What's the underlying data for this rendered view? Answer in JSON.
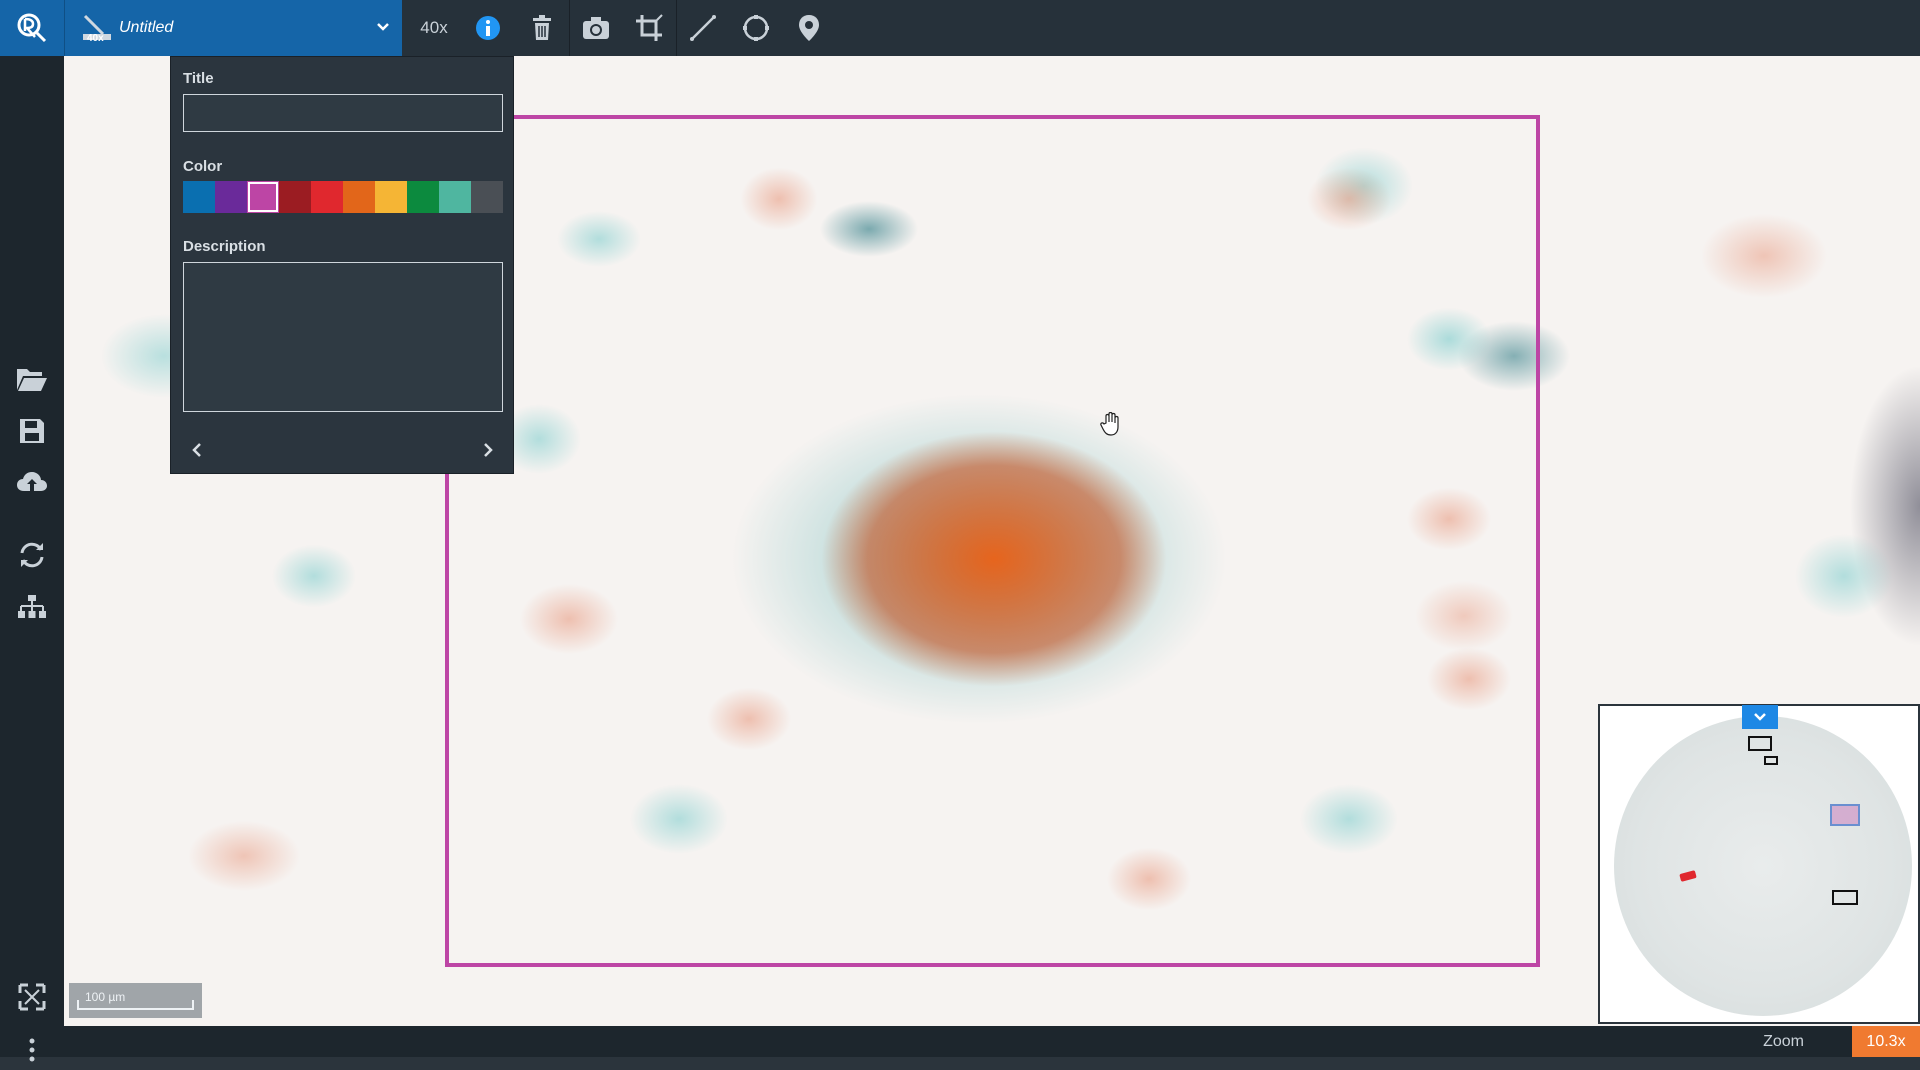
{
  "app": {
    "brand": "logo"
  },
  "slide": {
    "name": "Untitled",
    "thumb_magnification": "40x"
  },
  "toolbar": {
    "magnification": "40x",
    "icons": [
      "info-icon",
      "trash-icon",
      "camera-icon",
      "crop-icon",
      "ruler-line-icon",
      "circle-icon",
      "map-pin-icon"
    ]
  },
  "annotation_panel": {
    "title_label": "Title",
    "title_value": "",
    "color_label": "Color",
    "colors": [
      "#0a6fb0",
      "#6a2a9a",
      "#bd45a5",
      "#9b1c22",
      "#e0282e",
      "#e2661a",
      "#f5b535",
      "#0c8a3e",
      "#4fb6a0",
      "#4a4f55"
    ],
    "selected_color_index": 2,
    "description_label": "Description",
    "description_value": ""
  },
  "sidebar": {
    "icons": [
      "folder-open-icon",
      "save-icon",
      "cloud-upload-icon",
      "refresh-icon",
      "sitemap-icon",
      "fit-screen-icon",
      "more-vert-icon"
    ]
  },
  "viewer": {
    "scale_label": "100 µm",
    "roi_color": "#bd45a5"
  },
  "status": {
    "zoom_label": "Zoom",
    "zoom_value": "10.3x"
  }
}
